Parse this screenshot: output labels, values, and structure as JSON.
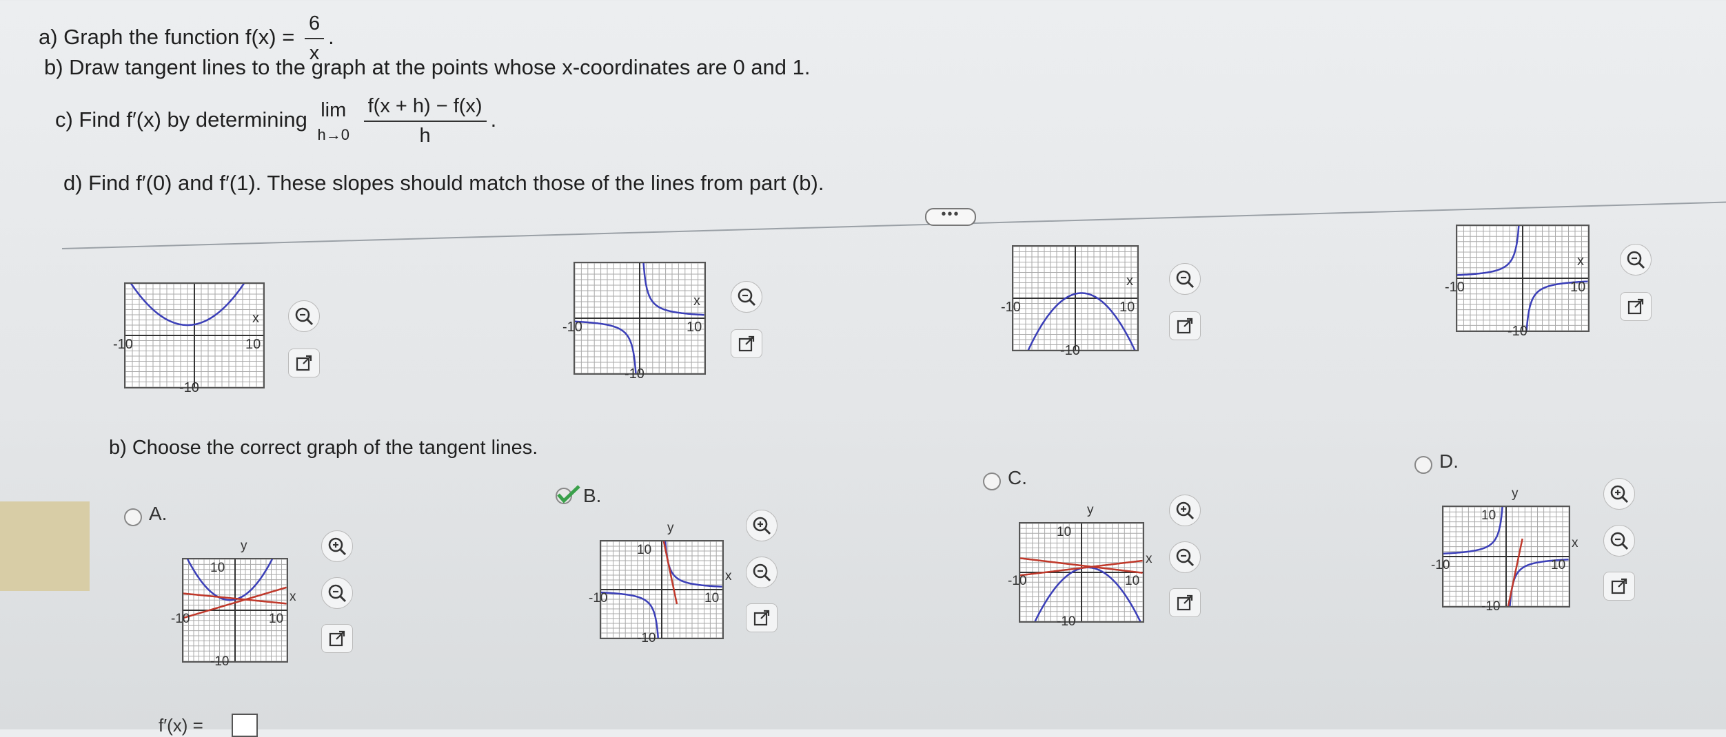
{
  "question": {
    "a": {
      "prefix": "a) Graph the function f(x) =",
      "num": "6",
      "den": "x",
      "suffix": "."
    },
    "b": "b) Draw tangent lines to the graph at the points whose x-coordinates are 0 and 1.",
    "c": {
      "prefix": "c) Find f′(x) by determining",
      "lim": "lim",
      "lim_sub": "h→0",
      "num": "f(x + h) − f(x)",
      "den": "h",
      "suffix": "."
    },
    "d": "d) Find f′(0) and f′(1). These slopes should match those of the lines from part (b)."
  },
  "more_button": "•••",
  "part_a_graphs": [
    {
      "axis_x": "x",
      "tick_neg": "-10",
      "tick_pos": "10",
      "tick_bottom": "-10",
      "curve": "parabola-up"
    },
    {
      "axis_x": "x",
      "tick_neg": "-10",
      "tick_pos": "10",
      "tick_bottom": "-10",
      "curve": "hyperbola-decreasing"
    },
    {
      "axis_x": "x",
      "tick_neg": "-10",
      "tick_pos": "10",
      "tick_bottom": "-10",
      "curve": "parabola-down"
    },
    {
      "axis_x": "x",
      "tick_neg": "-10",
      "tick_pos": "10",
      "tick_bottom": "-10",
      "curve": "hyperbola-increasing"
    }
  ],
  "part_b": {
    "prompt": "b) Choose the correct graph of the tangent lines.",
    "options": [
      {
        "label": "A.",
        "axis_x": "x",
        "axis_y": "y",
        "tick_top": "10",
        "tick_neg": "-10",
        "tick_pos": "10",
        "tick_bottom": "-10",
        "selected": false
      },
      {
        "label": "B.",
        "axis_x": "x",
        "axis_y": "y",
        "tick_top": "10",
        "tick_neg": "-10",
        "tick_pos": "10",
        "tick_bottom": "-10",
        "selected": true
      },
      {
        "label": "C.",
        "axis_x": "x",
        "axis_y": "y",
        "tick_top": "10",
        "tick_neg": "-10",
        "tick_pos": "10",
        "tick_bottom": "-10",
        "selected": false
      },
      {
        "label": "D.",
        "axis_x": "x",
        "axis_y": "y",
        "tick_top": "10",
        "tick_neg": "-10",
        "tick_pos": "10",
        "tick_bottom": "-10",
        "selected": false
      }
    ]
  },
  "footer_partial": "f′(x) = ",
  "colors": {
    "curve": "#3b3fb8",
    "tangent": "#c0392b",
    "check": "#3aa04a"
  },
  "icons": [
    "zoom-in-icon",
    "zoom-out-icon",
    "popout-icon"
  ]
}
